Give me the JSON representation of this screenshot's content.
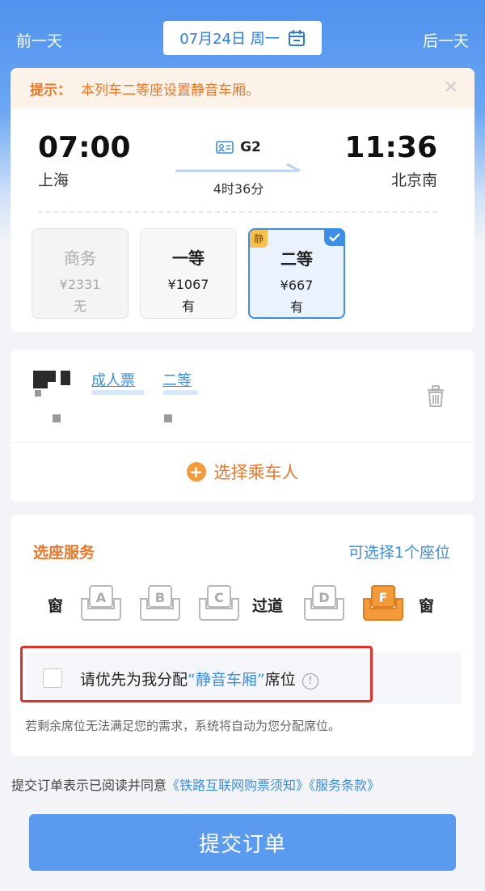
{
  "date_nav": {
    "prev_label": "前一天",
    "date_label": "07月24日 周一",
    "next_label": "后一天"
  },
  "notice": {
    "label": "提示：",
    "text": "本列车二等座设置静音车厢。",
    "close_icon": "close-icon"
  },
  "train": {
    "departure_time": "07:00",
    "departure_station": "上海",
    "arrival_time": "11:36",
    "arrival_station": "北京南",
    "train_number": "G2",
    "duration": "4时36分"
  },
  "seat_classes": [
    {
      "name": "商务",
      "price": "¥2331",
      "availability": "无"
    },
    {
      "name": "一等",
      "price": "¥1067",
      "availability": "有"
    },
    {
      "name": "二等",
      "price": "¥667",
      "availability": "有",
      "tag": "静",
      "selected": true
    }
  ],
  "passenger": {
    "ticket_type": "成人票",
    "seat_class": "二等",
    "add_label": "选择乘车人"
  },
  "seat_service": {
    "title": "选座服务",
    "limit": "可选择1个座位",
    "window_label": "窗",
    "aisle_label": "过道",
    "seats": [
      {
        "letter": "A",
        "selected": false
      },
      {
        "letter": "B",
        "selected": false
      },
      {
        "letter": "C",
        "selected": false
      },
      {
        "letter": "D",
        "selected": false
      },
      {
        "letter": "F",
        "selected": true
      }
    ],
    "quiet_prefix": "请优先为我分配",
    "quiet_highlight": "“静音车厢”",
    "quiet_suffix": "席位",
    "note": "若剩余席位无法满足您的需求，系统将自动为您分配席位。"
  },
  "agreement": {
    "prefix": "提交订单表示已阅读并同意",
    "link1": "《铁路互联网购票须知》",
    "link2": "《服务条款》"
  },
  "submit_label": "提交订单",
  "colors": {
    "primary_blue": "#3b8de8",
    "accent_orange": "#e8772a",
    "selected_seat": "#f39a3a",
    "highlight_red": "#e0302a"
  }
}
